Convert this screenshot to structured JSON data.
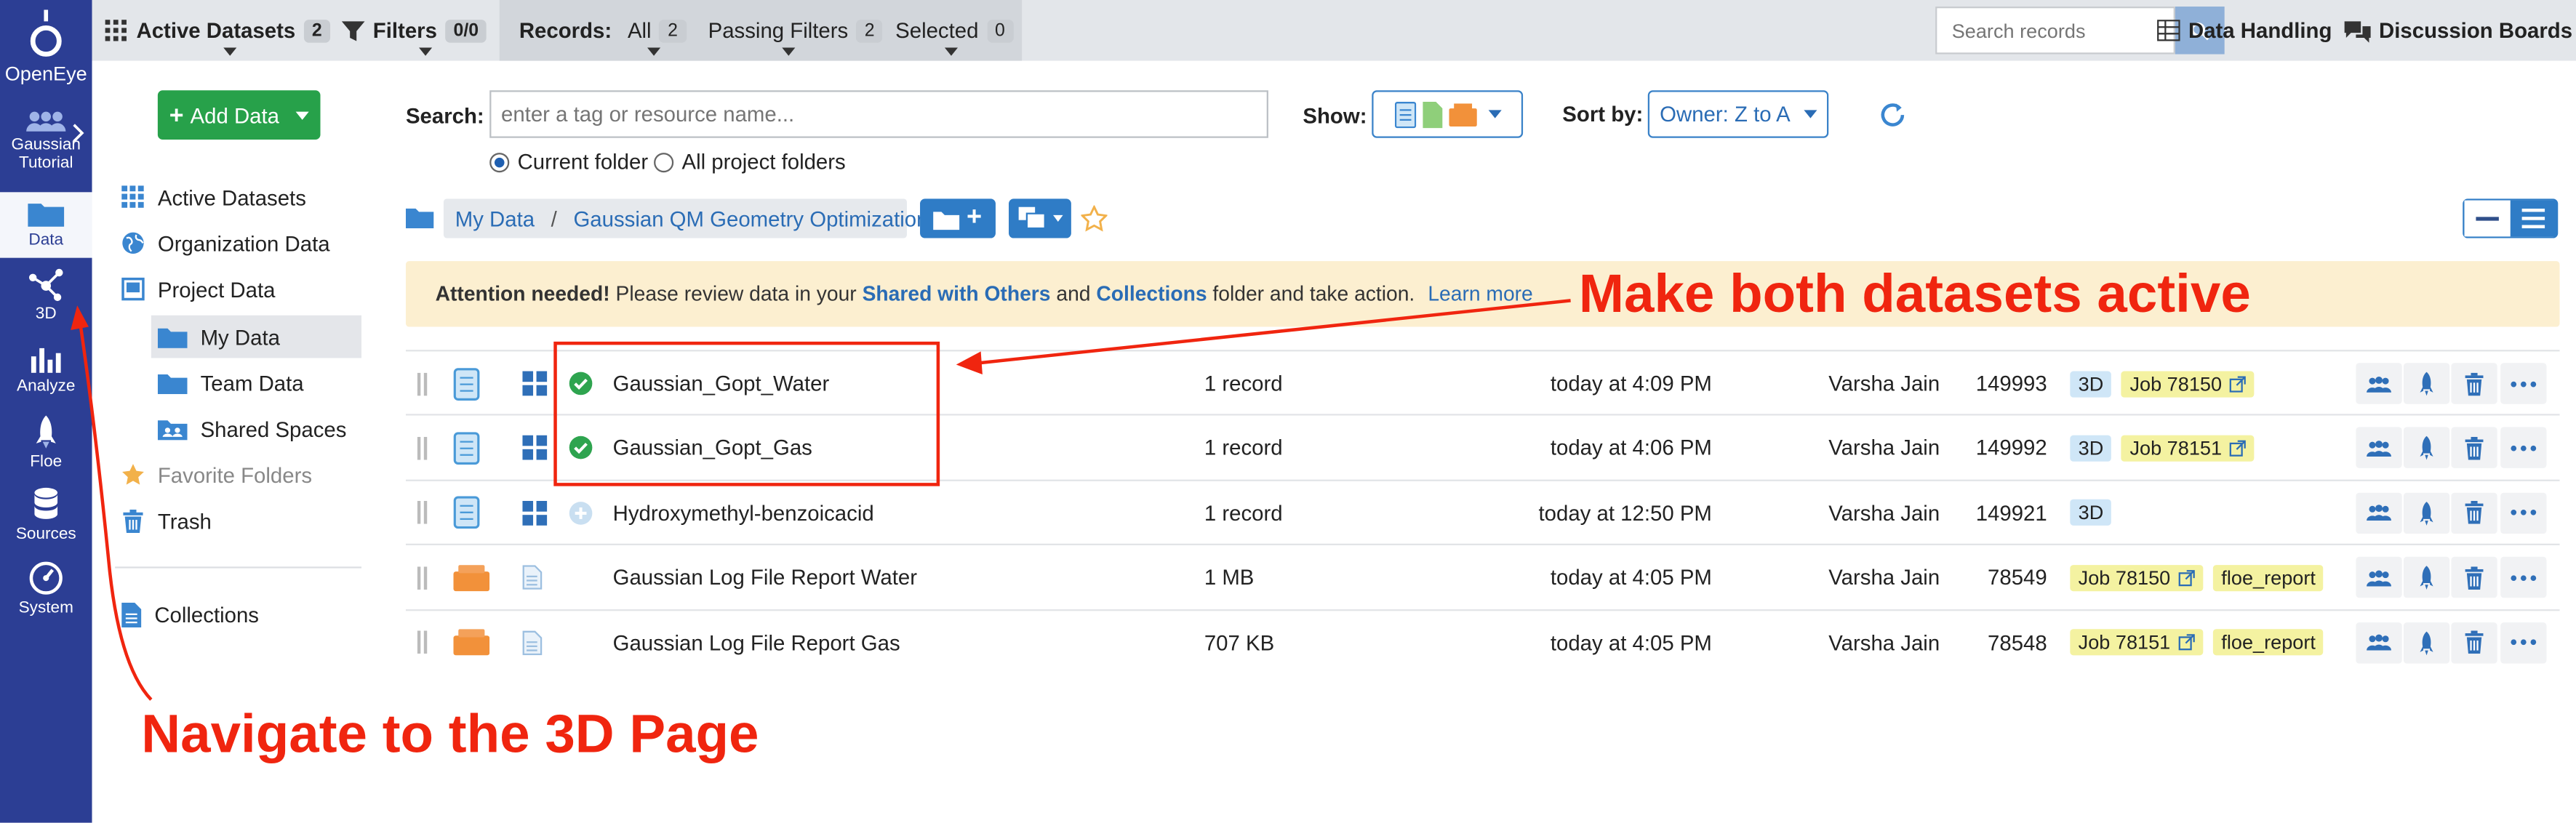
{
  "leftnav": {
    "brand": "OpenEye",
    "project": [
      "Gaussian",
      "Tutorial"
    ],
    "items": [
      {
        "label": "Data",
        "icon": "folder-icon",
        "active": true
      },
      {
        "label": "3D",
        "icon": "molecule-icon",
        "active": false
      },
      {
        "label": "Analyze",
        "icon": "bar-chart-icon",
        "active": false
      },
      {
        "label": "Floe",
        "icon": "rocket-icon",
        "active": false
      },
      {
        "label": "Sources",
        "icon": "database-icon",
        "active": false
      },
      {
        "label": "System",
        "icon": "gauge-icon",
        "active": false
      }
    ]
  },
  "topbar": {
    "active_datasets_label": "Active Datasets",
    "active_datasets_count": "2",
    "filters_label": "Filters",
    "filters_count": "0/0",
    "records_label": "Records:",
    "all_label": "All",
    "all_count": "2",
    "passing_label": "Passing Filters",
    "passing_count": "2",
    "selected_label": "Selected",
    "selected_count": "0",
    "search_placeholder": "Search records",
    "data_handling": "Data Handling",
    "discussion_boards": "Discussion Boards"
  },
  "sidebar": {
    "add_data": "Add Data",
    "items": [
      {
        "label": "Active Datasets",
        "icon": "grid-icon"
      },
      {
        "label": "Organization Data",
        "icon": "globe-icon"
      },
      {
        "label": "Project Data",
        "icon": "project-icon"
      },
      {
        "label": "My Data",
        "icon": "folder-icon",
        "selected": true
      },
      {
        "label": "Team Data",
        "icon": "folder-icon"
      },
      {
        "label": "Shared Spaces",
        "icon": "shared-folder-icon"
      },
      {
        "label": "Favorite Folders",
        "icon": "star-icon"
      },
      {
        "label": "Trash",
        "icon": "trash-icon"
      },
      {
        "label": "Collections",
        "icon": "document-icon"
      }
    ]
  },
  "main": {
    "search_label": "Search:",
    "search_placeholder": "enter a tag or resource name...",
    "show_label": "Show:",
    "sort_label": "Sort by:",
    "sort_value": "Owner: Z to A",
    "radio_current": "Current folder",
    "radio_all": "All project folders",
    "breadcrumb": [
      "My Data",
      "/",
      "Gaussian QM Geometry Optimization"
    ],
    "alert": {
      "strong": "Attention needed!",
      "text1": "Please review data in your",
      "link1": "Shared with Others",
      "text2": "and",
      "link2": "Collections",
      "text3": "folder and take action.",
      "learn": "Learn more"
    },
    "rows": [
      {
        "name": "Gaussian_Gopt_Water",
        "size": "1 record",
        "date": "today at 4:09 PM",
        "owner": "Varsha Jain",
        "id": "149993",
        "status": "active",
        "tags": [
          "3D",
          "Job 78150"
        ],
        "type": "dataset"
      },
      {
        "name": "Gaussian_Gopt_Gas",
        "size": "1 record",
        "date": "today at 4:06 PM",
        "owner": "Varsha Jain",
        "id": "149992",
        "status": "active",
        "tags": [
          "3D",
          "Job 78151"
        ],
        "type": "dataset"
      },
      {
        "name": "Hydroxymethyl-benzoicacid",
        "size": "1 record",
        "date": "today at 12:50 PM",
        "owner": "Varsha Jain",
        "id": "149921",
        "status": "inactive",
        "tags": [
          "3D"
        ],
        "type": "dataset"
      },
      {
        "name": "Gaussian Log File Report Water",
        "size": "1 MB",
        "date": "today at 4:05 PM",
        "owner": "Varsha Jain",
        "id": "78549",
        "status": "none",
        "tags": [
          "Job 78150",
          "floe_report"
        ],
        "type": "file"
      },
      {
        "name": "Gaussian Log File Report Gas",
        "size": "707 KB",
        "date": "today at 4:05 PM",
        "owner": "Varsha Jain",
        "id": "78548",
        "status": "none",
        "tags": [
          "Job 78151",
          "floe_report"
        ],
        "type": "file"
      }
    ]
  },
  "annotations": {
    "datasets_note": "Make both datasets active",
    "nav_note": "Navigate to the 3D Page"
  },
  "colors": {
    "nav": "#2c3e94",
    "accent": "#2f7cc6",
    "green": "#27a14a",
    "annotation": "#f0250f"
  }
}
